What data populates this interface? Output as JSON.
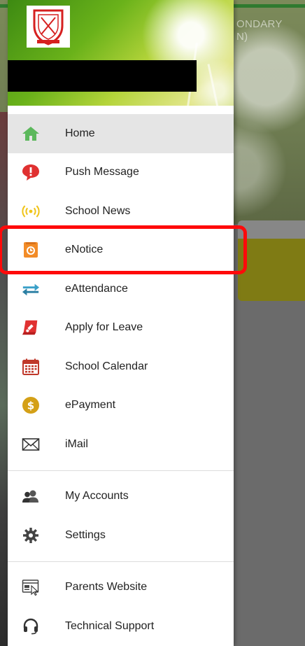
{
  "background": {
    "title_line1": "ONDARY",
    "title_line2": "N)"
  },
  "header": {
    "logo_icon": "school-crest-icon"
  },
  "menu": {
    "items": [
      {
        "label": "Home",
        "icon": "home-icon",
        "active": true
      },
      {
        "label": "Push Message",
        "icon": "push-message-icon"
      },
      {
        "label": "School News",
        "icon": "school-news-icon"
      },
      {
        "label": "eNotice",
        "icon": "enotice-icon"
      },
      {
        "label": "eAttendance",
        "icon": "eattendance-icon"
      },
      {
        "label": "Apply for Leave",
        "icon": "apply-leave-icon"
      },
      {
        "label": "School Calendar",
        "icon": "calendar-icon"
      },
      {
        "label": "ePayment",
        "icon": "epayment-icon"
      },
      {
        "label": "iMail",
        "icon": "mail-icon"
      }
    ],
    "account_items": [
      {
        "label": "My Accounts",
        "icon": "accounts-icon"
      },
      {
        "label": "Settings",
        "icon": "settings-gear-icon"
      }
    ],
    "support_items": [
      {
        "label": "Parents Website",
        "icon": "website-icon"
      },
      {
        "label": "Technical Support",
        "icon": "headset-icon"
      }
    ]
  },
  "colors": {
    "highlight": "#ff0a0a",
    "home_icon": "#5cb85c",
    "push_icon": "#e03131",
    "news_icon": "#f0c419",
    "enotice_icon": "#f28c28",
    "attendance_icon": "#3aa0c8",
    "leave_icon": "#e03131",
    "calendar_icon": "#c0392b",
    "payment_icon": "#d4a017"
  }
}
